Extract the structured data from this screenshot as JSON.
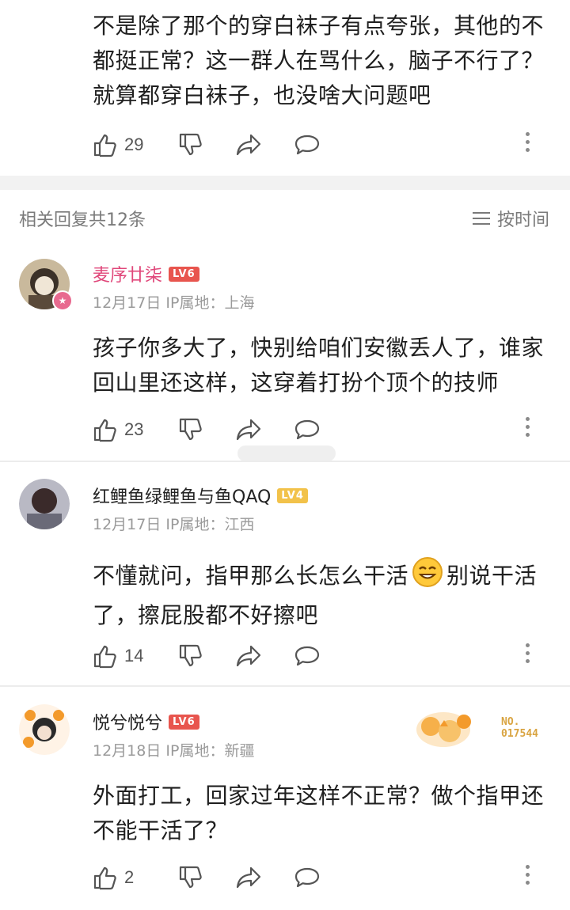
{
  "top_comment": {
    "text": "不是除了那个的穿白袜子有点夸张，其他的不都挺正常？这一群人在骂什么，脑子不行了？就算都穿白袜子，也没啥大问题吧",
    "likes": "29"
  },
  "replies_header": {
    "title": "相关回复共12条",
    "sort_label": "按时间"
  },
  "replies": [
    {
      "username": "麦序廿柒",
      "username_color": "#e0477a",
      "level": "LV6",
      "level_color": "#e8554e",
      "date": "12月17日",
      "ip": "IP属地：上海",
      "text": "孩子你多大了，快别给咱们安徽丢人了，谁家回山里还这样，这穿着打扮个顶个的技师",
      "likes": "23"
    },
    {
      "username": "红鲤鱼绿鲤鱼与鱼QAQ",
      "username_color": "#222222",
      "level": "LV4",
      "level_color": "#f2c24a",
      "date": "12月17日",
      "ip": "IP属地：江西",
      "text_before": "不懂就问，指甲那么长怎么干活",
      "text_after": "别说干活了，擦屁股都不好擦吧",
      "likes": "14"
    },
    {
      "username": "悦兮悦兮",
      "username_color": "#222222",
      "level": "LV6",
      "level_color": "#e8554e",
      "date": "12月18日",
      "ip": "IP属地：新疆",
      "text": "外面打工，回家过年这样不正常？做个指甲还不能干活了？",
      "likes": "2",
      "badge_no": "NO.\n017544"
    }
  ],
  "icons": [
    "thumb-up-icon",
    "thumb-down-icon",
    "share-icon",
    "comment-icon",
    "more-icon",
    "sort-icon",
    "smile-emoji"
  ],
  "colors": {
    "divider": "#ececec",
    "band": "#f2f2f2",
    "muted": "#9a9a9a"
  }
}
